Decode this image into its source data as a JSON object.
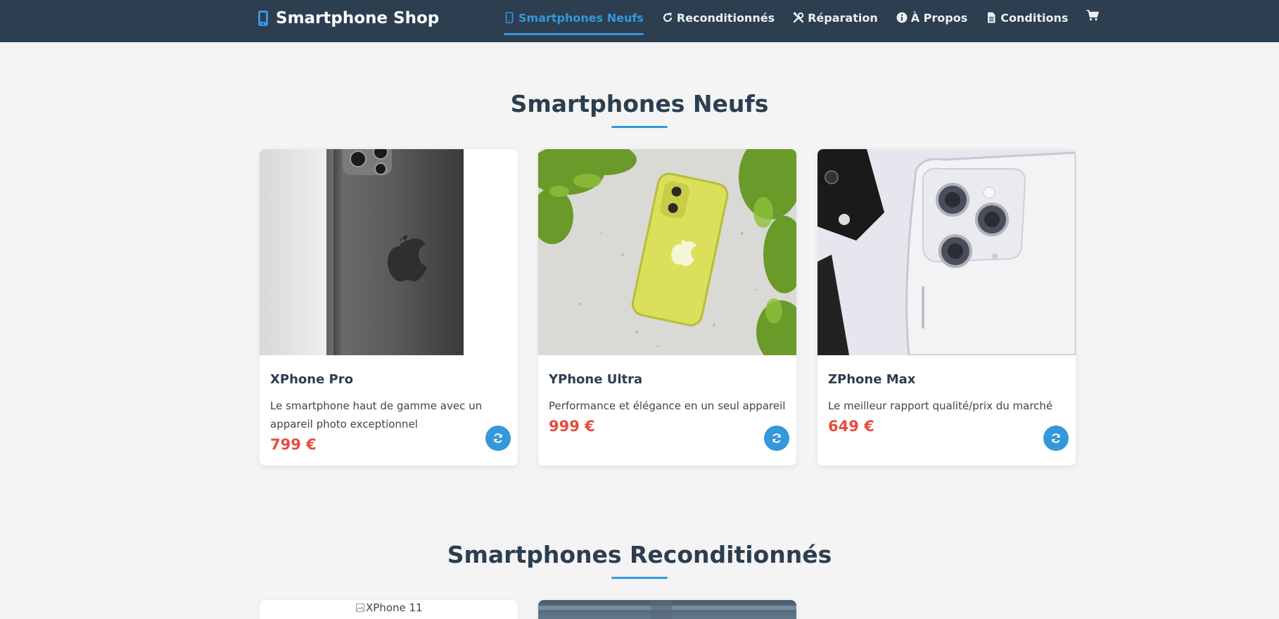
{
  "brand": {
    "title": "Smartphone Shop",
    "icon": "mobile-icon"
  },
  "nav": {
    "items": [
      {
        "label": "Smartphones Neufs",
        "icon": "mobile-icon",
        "active": true
      },
      {
        "label": "Reconditionnés",
        "icon": "rotate-icon"
      },
      {
        "label": "Réparation",
        "icon": "tools-icon"
      },
      {
        "label": "À Propos",
        "icon": "info-icon"
      },
      {
        "label": "Conditions",
        "icon": "document-icon"
      }
    ],
    "cart_icon": "cart-icon"
  },
  "sections": {
    "new": {
      "title": "Smartphones Neufs"
    },
    "refurbished": {
      "title": "Smartphones Reconditionnés"
    }
  },
  "products": [
    {
      "name": "XPhone Pro",
      "description": "Le smartphone haut de gamme avec un appareil photo exceptionnel",
      "price": "799 €"
    },
    {
      "name": "YPhone Ultra",
      "description": "Performance et élégance en un seul appareil",
      "price": "999 €"
    },
    {
      "name": "ZPhone Max",
      "description": "Le meilleur rapport qualité/prix du marché",
      "price": "649 €"
    }
  ],
  "refurbished_products": [
    {
      "image_alt": "XPhone 11"
    }
  ],
  "colors": {
    "navbar": "#2c3e50",
    "accent": "#3498db",
    "price": "#e74c3c",
    "background": "#f4f4f4"
  }
}
